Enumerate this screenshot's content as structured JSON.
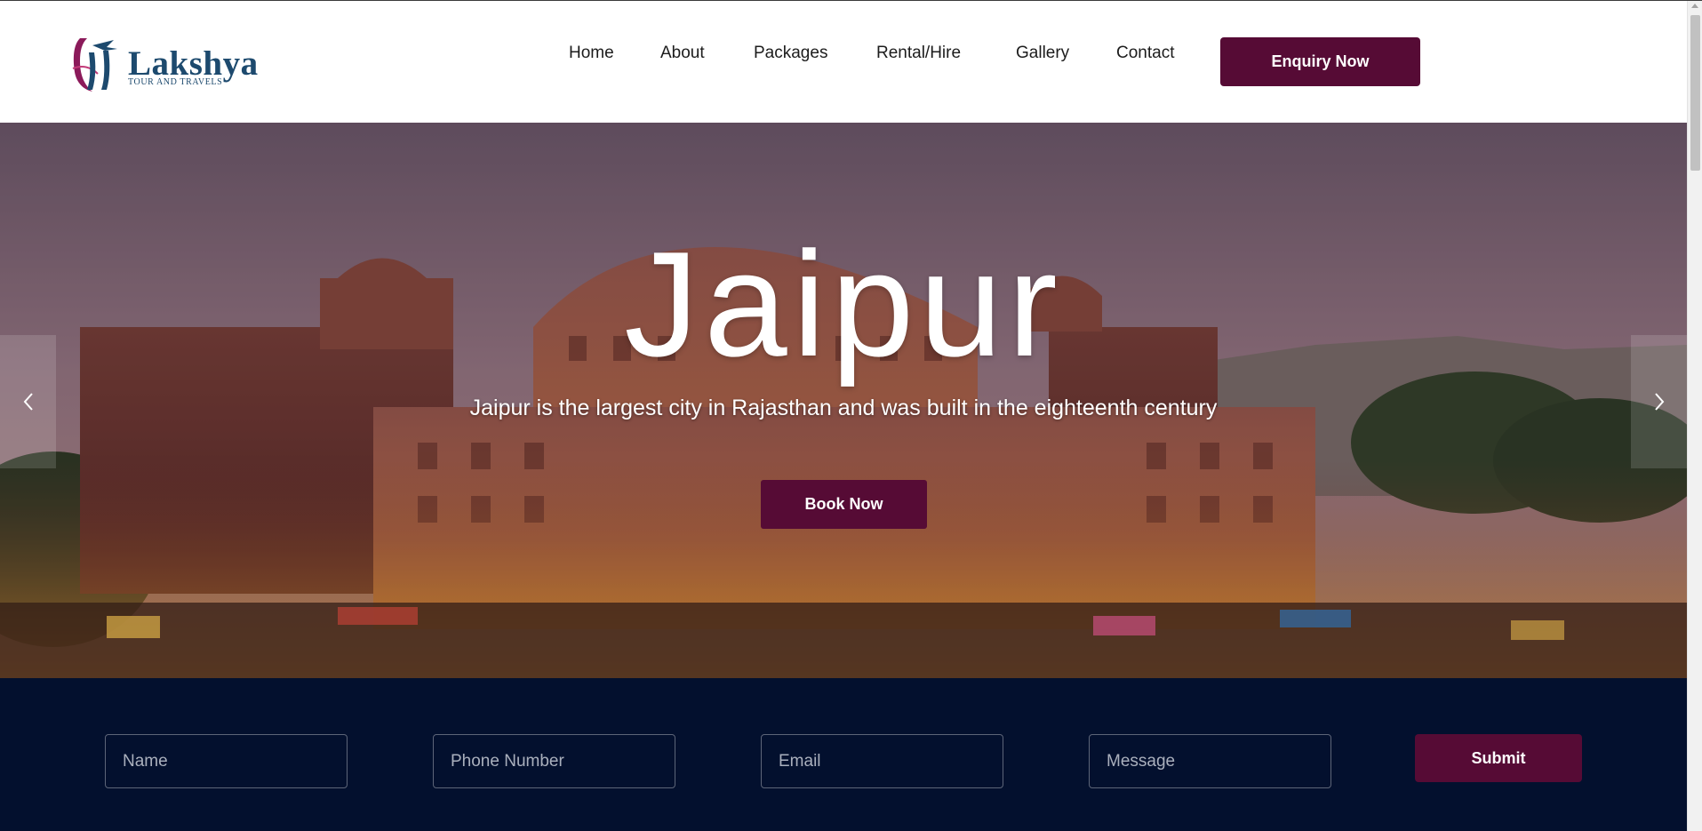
{
  "brand": {
    "name": "Lakshya",
    "tagline": "TOUR AND TRAVELS",
    "colors": {
      "primary": "#560b35",
      "logo_blue": "#1d4a6e",
      "form_band": "#03102e"
    }
  },
  "nav": {
    "items": [
      {
        "label": "Home"
      },
      {
        "label": "About"
      },
      {
        "label": "Packages"
      },
      {
        "label": "Rental/Hire"
      },
      {
        "label": "Gallery"
      },
      {
        "label": "Contact"
      }
    ],
    "cta_label": "Enquiry Now"
  },
  "hero": {
    "title": "Jaipur",
    "subtitle": "Jaipur is the largest city in Rajasthan and was built in the eighteenth century",
    "button_label": "Book Now",
    "prev_icon": "chevron-left-icon",
    "next_icon": "chevron-right-icon"
  },
  "enquiry_form": {
    "name_placeholder": "Name",
    "phone_placeholder": "Phone Number",
    "email_placeholder": "Email",
    "message_placeholder": "Message",
    "submit_label": "Submit"
  }
}
